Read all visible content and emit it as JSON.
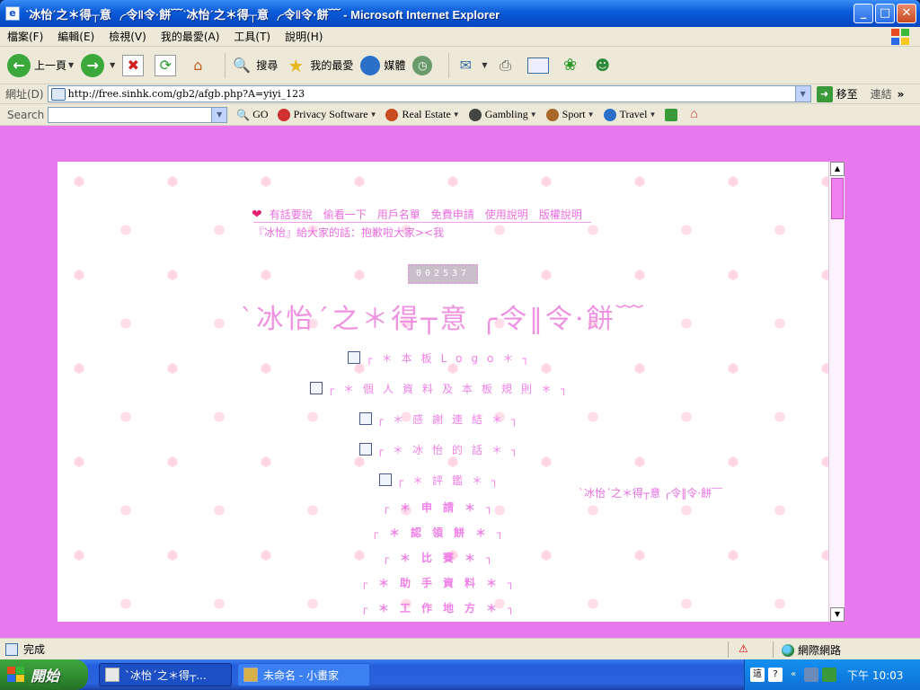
{
  "window": {
    "title": "ˋ冰怡ˊ之＊得┬意 ╭令‖令·餅﹋ˋ冰怡ˊ之＊得┬意 ╭令‖令·餅﹋ - Microsoft Internet Explorer",
    "minimize": "_",
    "maximize": "□",
    "close": "✕"
  },
  "menu": [
    "檔案(F)",
    "編輯(E)",
    "檢視(V)",
    "我的最愛(A)",
    "工具(T)",
    "說明(H)"
  ],
  "toolbar": {
    "back": "上一頁",
    "search": "搜尋",
    "favorites": "我的最愛",
    "media": "媒體"
  },
  "address": {
    "label": "網址(D)",
    "url": "http://free.sinhk.com/gb2/afgb.php?A=yiyi_123",
    "go": "移至",
    "links": "連結"
  },
  "searchbar": {
    "label": "Search",
    "go": "GO",
    "items": [
      "Privacy Software",
      "Real Estate",
      "Gambling",
      "Sport",
      "Travel"
    ]
  },
  "page": {
    "nav_links": [
      "有話要說",
      "偷看一下",
      "用戶名單",
      "免費申請",
      "使用說明",
      "版權說明"
    ],
    "notice": "『冰怡』給大家的話：抱歉啦大家><我",
    "counter": "002537",
    "big_title": "ˋ冰怡ˊ之＊得┬意 ╭令‖令·餅﹋",
    "menu_items": [
      "┌＊本板Logo＊┐",
      "┌＊個人資料及本板規則＊┐",
      "┌＊感謝連結＊┐",
      "┌＊冰怡的話＊┐",
      "┌＊評鑑＊┐"
    ],
    "bold_items": [
      "┌＊申請＊┐",
      "┌＊認領餅＊┐",
      "┌＊比賽＊┐",
      "┌＊助手資料＊┐",
      "┌＊工作地方＊┐"
    ],
    "side_text": "ˋ冰怡ˊ之＊得┬意 ╭令‖令·餅﹋"
  },
  "status": {
    "text": "完成",
    "zone": "網際網路"
  },
  "taskbar": {
    "start": "開始",
    "tasks": [
      "ˋ冰怡ˊ之＊得┬...",
      "未命名 - 小畫家"
    ],
    "clock": "下午 10:03"
  },
  "colors": {
    "page_bg": "#e878ee",
    "accent_pink": "#f080e8"
  }
}
